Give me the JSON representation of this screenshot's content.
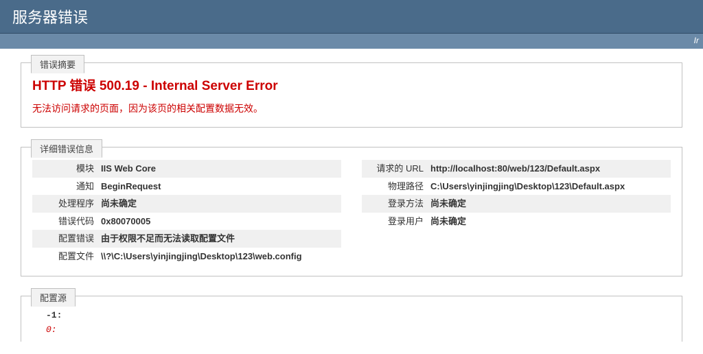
{
  "header": {
    "title": "服务器错误",
    "rightText": "Ir"
  },
  "summary": {
    "tab": "错误摘要",
    "title": "HTTP 错误  500.19 - Internal Server Error",
    "subtitle": "无法访问请求的页面，因为该页的相关配置数据无效。"
  },
  "details": {
    "tab": "详细错误信息",
    "left": [
      {
        "label": "模块",
        "value": "IIS Web Core",
        "bold": true,
        "alt": true
      },
      {
        "label": "通知",
        "value": "BeginRequest",
        "bold": true,
        "alt": false
      },
      {
        "label": "处理程序",
        "value": "尚未确定",
        "bold": true,
        "alt": true
      },
      {
        "label": "错误代码",
        "value": "0x80070005",
        "bold": true,
        "alt": false
      },
      {
        "label": "配置错误",
        "value": "由于权限不足而无法读取配置文件",
        "bold": true,
        "alt": true
      },
      {
        "label": "配置文件",
        "value": "\\\\?\\C:\\Users\\yinjingjing\\Desktop\\123\\web.config",
        "bold": true,
        "alt": false
      }
    ],
    "right": [
      {
        "label": "请求的 URL",
        "value": "http://localhost:80/web/123/Default.aspx",
        "bold": true,
        "alt": true
      },
      {
        "label": "物理路径",
        "value": "C:\\Users\\yinjingjing\\Desktop\\123\\Default.aspx",
        "bold": true,
        "alt": false
      },
      {
        "label": "登录方法",
        "value": "尚未确定",
        "bold": true,
        "alt": true
      },
      {
        "label": "登录用户",
        "value": "尚未确定",
        "bold": true,
        "alt": false
      }
    ]
  },
  "configSource": {
    "tab": "配置源",
    "line1": "   -1: ",
    "line2": "    0: "
  }
}
